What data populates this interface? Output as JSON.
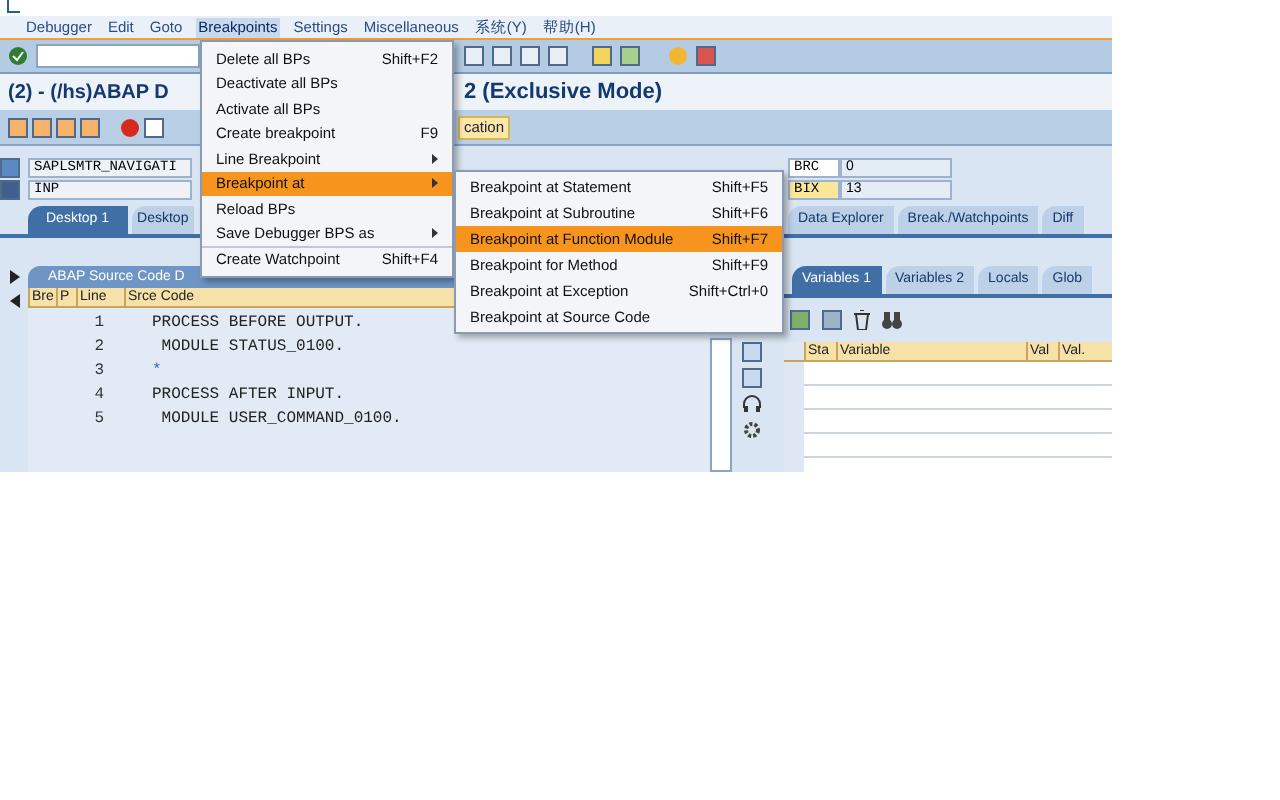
{
  "window": {
    "title_left": "(2) - (/hs)ABAP D",
    "title_right": "2 (Exclusive Mode)"
  },
  "menu_bar": [
    {
      "label": "Debugger",
      "selected": false
    },
    {
      "label": "Edit",
      "selected": false
    },
    {
      "label": "Goto",
      "selected": false
    },
    {
      "label": "Breakpoints",
      "selected": true
    },
    {
      "label": "Settings",
      "selected": false
    },
    {
      "label": "Miscellaneous",
      "selected": false
    },
    {
      "label": "系统(Y)",
      "selected": false
    },
    {
      "label": "帮助(H)",
      "selected": false
    }
  ],
  "app_toolbar": {
    "button_label": "cation"
  },
  "fields": [
    {
      "name": "SAPLSMTR_NAVIGATI",
      "var": "BRC",
      "value": "0",
      "highlighted": false
    },
    {
      "name": "INP",
      "var": "BIX",
      "value": "13",
      "highlighted": true
    }
  ],
  "desktop_tabs": [
    {
      "label": "Desktop 1",
      "selected": true
    },
    {
      "label": "Desktop",
      "selected": false
    }
  ],
  "tool_tabs": [
    {
      "label": "Data Explorer",
      "selected": false
    },
    {
      "label": "Break./Watchpoints",
      "selected": false
    },
    {
      "label": "Diff",
      "selected": false
    }
  ],
  "source_panel": {
    "title": "ABAP Source Code D",
    "columns": [
      "Bre",
      "P",
      "Line",
      "Srce Code"
    ],
    "rows": [
      {
        "line": "1",
        "code": "PROCESS BEFORE OUTPUT.",
        "kind": "statement"
      },
      {
        "line": "2",
        "code": " MODULE STATUS_0100.",
        "kind": "statement"
      },
      {
        "line": "3",
        "code": "*",
        "kind": "comment"
      },
      {
        "line": "4",
        "code": "PROCESS AFTER INPUT.",
        "kind": "statement"
      },
      {
        "line": "5",
        "code": " MODULE USER_COMMAND_0100.",
        "kind": "statement"
      }
    ]
  },
  "variables_panel": {
    "tabs": [
      {
        "label": "Variables 1",
        "selected": true
      },
      {
        "label": "Variables 2",
        "selected": false
      },
      {
        "label": "Locals",
        "selected": false
      },
      {
        "label": "Glob",
        "selected": false
      }
    ],
    "columns": [
      "Sta",
      "Variable",
      "Val",
      "Val."
    ]
  },
  "breakpoints_menu": {
    "items": [
      {
        "label": "Delete all BPs",
        "shortcut": "Shift+F2",
        "submenu": false,
        "selected": false
      },
      {
        "label": "Deactivate all BPs",
        "submenu": false,
        "selected": false
      },
      {
        "label": "Activate all BPs",
        "submenu": false,
        "selected": false
      },
      {
        "label": "Create breakpoint",
        "shortcut": "F9",
        "submenu": false,
        "selected": false
      },
      {
        "label": "Line Breakpoint",
        "submenu": true,
        "selected": false
      },
      {
        "label": "Breakpoint at",
        "submenu": true,
        "selected": true
      },
      {
        "label": "Reload BPs",
        "submenu": false,
        "selected": false
      },
      {
        "label": "Save Debugger BPS as",
        "submenu": true,
        "selected": false
      },
      {
        "label": "Create Watchpoint",
        "shortcut": "Shift+F4",
        "submenu": false,
        "selected": false
      }
    ]
  },
  "breakpoint_at_submenu": {
    "items": [
      {
        "label": "Breakpoint at Statement",
        "shortcut": "Shift+F5",
        "selected": false
      },
      {
        "label": "Breakpoint at Subroutine",
        "shortcut": "Shift+F6",
        "selected": false
      },
      {
        "label": "Breakpoint at Function Module",
        "shortcut": "Shift+F7",
        "selected": true
      },
      {
        "label": "Breakpoint for Method",
        "shortcut": "Shift+F9",
        "selected": false
      },
      {
        "label": "Breakpoint at Exception",
        "shortcut": "Shift+Ctrl+0",
        "selected": false
      },
      {
        "label": "Breakpoint at Source Code",
        "selected": false
      }
    ]
  }
}
